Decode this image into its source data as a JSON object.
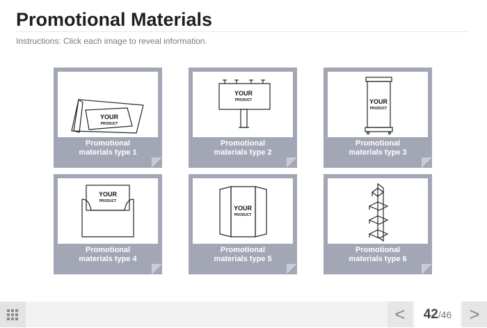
{
  "page": {
    "title": "Promotional Materials",
    "instructions": "Instructions: Click each image to reveal information."
  },
  "cards": [
    {
      "caption_line1": "Promotional",
      "caption_line2": "materials type 1",
      "icon": "table-tent-icon",
      "label_main": "YOUR",
      "label_sub": "PRODUCT"
    },
    {
      "caption_line1": "Promotional",
      "caption_line2": "materials type 2",
      "icon": "billboard-icon",
      "label_main": "YOUR",
      "label_sub": "PRODUCT"
    },
    {
      "caption_line1": "Promotional",
      "caption_line2": "materials type 3",
      "icon": "rollup-banner-icon",
      "label_main": "YOUR",
      "label_sub": "PRODUCT"
    },
    {
      "caption_line1": "Promotional",
      "caption_line2": "materials type 4",
      "icon": "brochure-holder-icon",
      "label_main": "YOUR",
      "label_sub": "PRODUCT"
    },
    {
      "caption_line1": "Promotional",
      "caption_line2": "materials type 5",
      "icon": "trifold-display-icon",
      "label_main": "YOUR",
      "label_sub": "PRODUCT"
    },
    {
      "caption_line1": "Promotional",
      "caption_line2": "materials type 6",
      "icon": "shelf-stand-icon"
    }
  ],
  "footer": {
    "menu_icon": "grid-menu-icon",
    "prev_icon": "chevron-left-icon",
    "next_icon": "chevron-right-icon",
    "prev_label": "<",
    "next_label": ">",
    "current_page": "42",
    "total_pages": "/46"
  },
  "colors": {
    "card_bg": "#a3a6b5",
    "title": "#1f1f1f",
    "footer_bg": "#f2f2f2"
  }
}
